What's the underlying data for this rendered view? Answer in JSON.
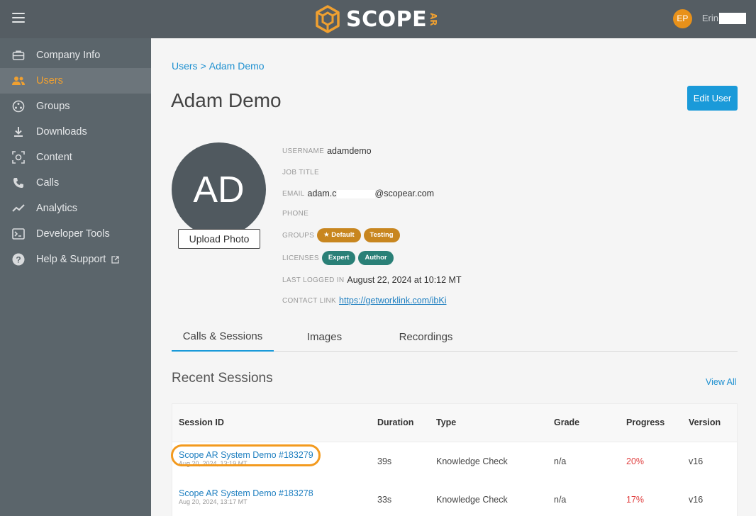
{
  "header": {
    "brand": "SCOPE",
    "brand_suffix": "AR",
    "avatar_initials": "EP",
    "user_name": "Erin"
  },
  "sidebar": {
    "items": [
      {
        "label": "Company Info",
        "icon": "briefcase-icon",
        "active": false
      },
      {
        "label": "Users",
        "icon": "users-icon",
        "active": true
      },
      {
        "label": "Groups",
        "icon": "groups-icon",
        "active": false
      },
      {
        "label": "Downloads",
        "icon": "download-icon",
        "active": false
      },
      {
        "label": "Content",
        "icon": "content-icon",
        "active": false
      },
      {
        "label": "Calls",
        "icon": "phone-icon",
        "active": false
      },
      {
        "label": "Analytics",
        "icon": "analytics-icon",
        "active": false
      },
      {
        "label": "Developer Tools",
        "icon": "terminal-icon",
        "active": false
      },
      {
        "label": "Help & Support",
        "icon": "help-icon",
        "active": false,
        "external": true
      }
    ]
  },
  "breadcrumb": {
    "root": "Users",
    "separator": ">",
    "current": "Adam Demo"
  },
  "page": {
    "title": "Adam Demo",
    "edit_button": "Edit User",
    "avatar_initials": "AD",
    "upload_button": "Upload Photo"
  },
  "profile": {
    "username_label": "USERNAME",
    "username": "adamdemo",
    "job_title_label": "JOB TITLE",
    "email_label": "EMAIL",
    "email_prefix": "adam.c",
    "email_suffix": "@scopear.com",
    "phone_label": "PHONE",
    "groups_label": "GROUPS",
    "groups": [
      "★ Default",
      "Testing"
    ],
    "licenses_label": "LICENSES",
    "licenses": [
      "Expert",
      "Author"
    ],
    "last_logged_label": "LAST LOGGED IN",
    "last_logged": "August 22, 2024 at 10:12 MT",
    "contact_label": "CONTACT LINK",
    "contact_link": "https://getworklink.com/ibKi"
  },
  "tabs": [
    "Calls & Sessions",
    "Images",
    "Recordings"
  ],
  "sessions": {
    "title": "Recent Sessions",
    "view_all": "View All",
    "columns": [
      "Session ID",
      "Duration",
      "Type",
      "Grade",
      "Progress",
      "Version"
    ],
    "rows": [
      {
        "name": "Scope AR System Demo #183279",
        "date": "Aug 20, 2024, 13:19 MT",
        "duration": "39s",
        "type": "Knowledge Check",
        "grade": "n/a",
        "progress": "20%",
        "version": "v16"
      },
      {
        "name": "Scope AR System Demo #183278",
        "date": "Aug 20, 2024, 13:17 MT",
        "duration": "33s",
        "type": "Knowledge Check",
        "grade": "n/a",
        "progress": "17%",
        "version": "v16"
      }
    ]
  },
  "colors": {
    "accent": "#f0a030",
    "link": "#1e90d0",
    "button": "#1a9ad9",
    "topbar": "#555d63",
    "sidebar": "#5b656b",
    "pill_orange": "#c8861f",
    "pill_teal": "#2a8077",
    "progress": "#e04040"
  }
}
